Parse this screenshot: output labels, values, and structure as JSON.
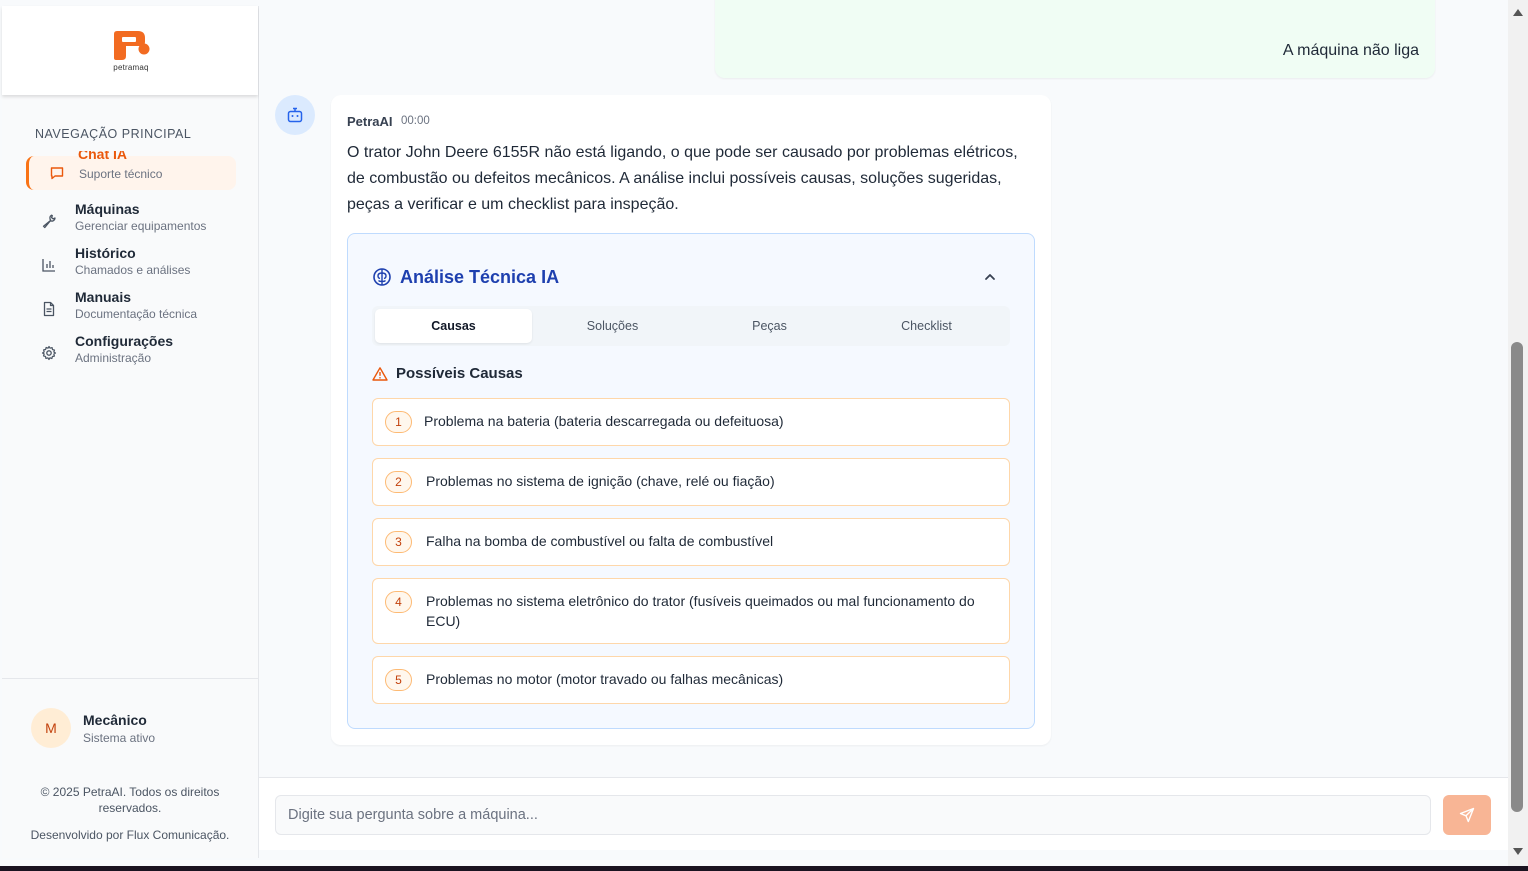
{
  "brand": {
    "logo_text": "petramaq",
    "accent": "#f97316"
  },
  "sidebar": {
    "section_title": "NAVEGAÇÃO PRINCIPAL",
    "items": [
      {
        "label": "Chat IA",
        "sub": "Suporte técnico",
        "icon": "message-square-icon",
        "active": true
      },
      {
        "label": "Máquinas",
        "sub": "Gerenciar equipamentos",
        "icon": "wrench-icon"
      },
      {
        "label": "Histórico",
        "sub": "Chamados e análises",
        "icon": "bar-chart-icon"
      },
      {
        "label": "Manuais",
        "sub": "Documentação técnica",
        "icon": "file-text-icon"
      },
      {
        "label": "Configurações",
        "sub": "Administração",
        "icon": "gear-icon"
      }
    ],
    "user": {
      "initial": "M",
      "name": "Mecânico",
      "status": "Sistema ativo"
    },
    "copyright": "© 2025 PetraAI. Todos os direitos reservados.",
    "developer": "Desenvolvido por Flux Comunicação."
  },
  "chat": {
    "user_message": "A máquina não liga",
    "bot": {
      "name": "PetraAI",
      "time": "00:00",
      "text": "O trator John Deere 6155R não está ligando, o que pode ser causado por problemas elétricos, de combustão ou defeitos mecânicos. A análise inclui possíveis causas, soluções sugeridas, peças a verificar e um checklist para inspeção."
    },
    "analysis": {
      "title": "Análise Técnica IA",
      "tabs": [
        "Causas",
        "Soluções",
        "Peças",
        "Checklist"
      ],
      "active_tab": "Causas",
      "causes_title": "Possíveis Causas",
      "causes": [
        {
          "num": "1",
          "text": "Problema na bateria (bateria descarregada ou defeituosa)"
        },
        {
          "num": "2",
          "text": "Problemas no sistema de ignição (chave, relé ou fiação)"
        },
        {
          "num": "3",
          "text": "Falha na bomba de combustível ou falta de combustível"
        },
        {
          "num": "4",
          "text": "Problemas no sistema eletrônico do trator (fusíveis queimados ou mal funcionamento do ECU)"
        },
        {
          "num": "5",
          "text": "Problemas no motor (motor travado ou falhas mecânicas)"
        }
      ]
    }
  },
  "composer": {
    "placeholder": "Digite sua pergunta sobre a máquina..."
  }
}
